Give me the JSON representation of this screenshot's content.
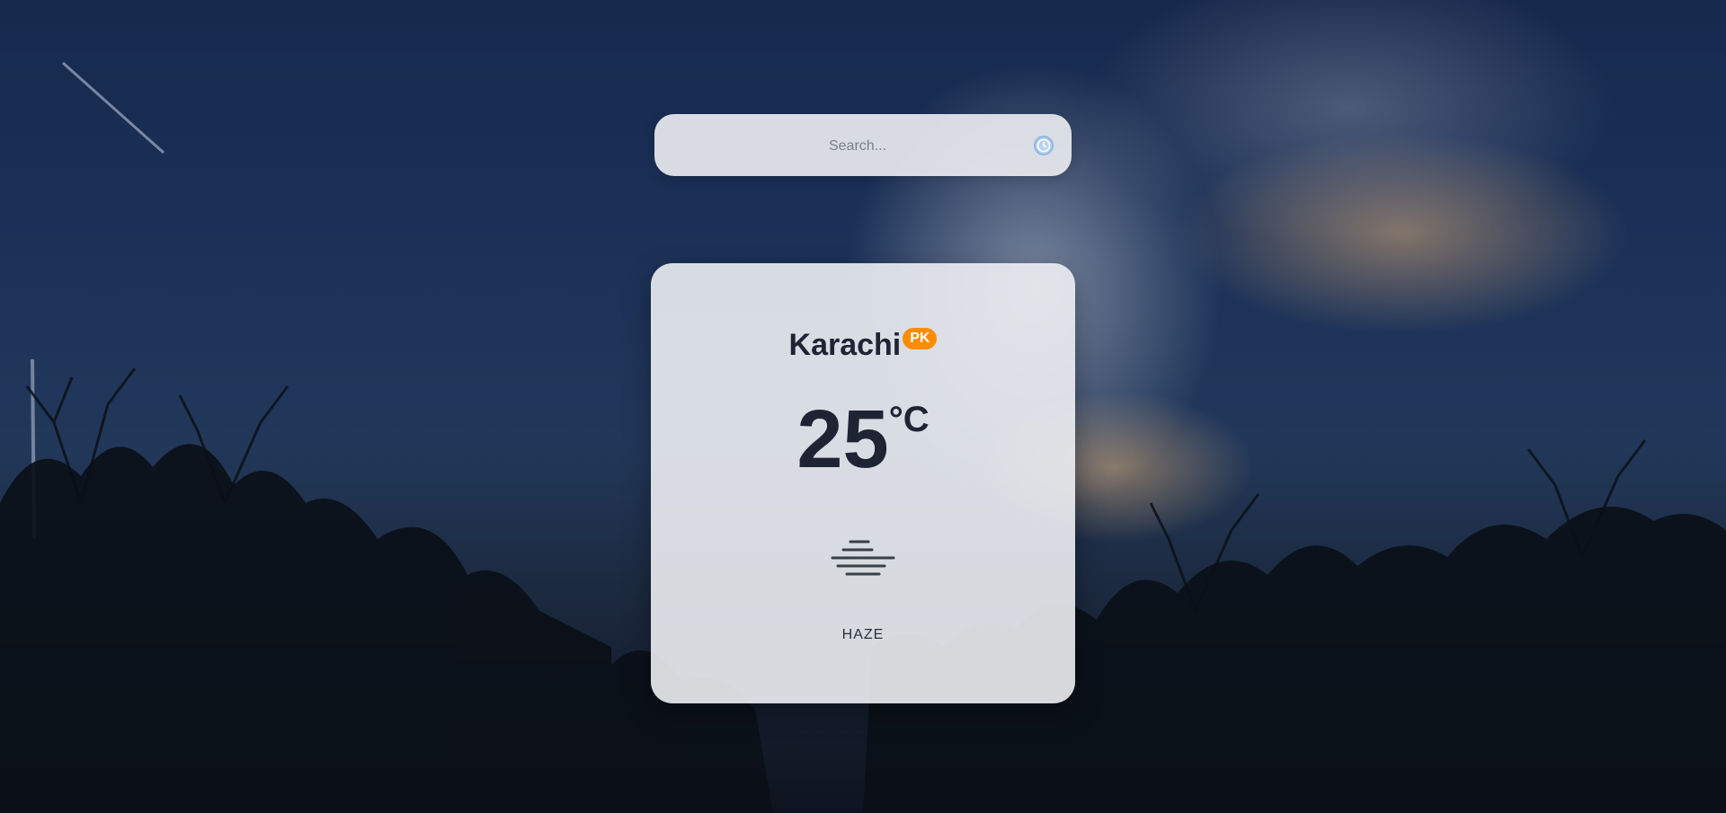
{
  "search": {
    "placeholder": "Search...",
    "icon": "clock-icon"
  },
  "weather": {
    "city": "Karachi",
    "country_code": "PK",
    "temperature": "25",
    "unit": "°C",
    "condition_icon": "haze-icon",
    "description": "HAZE"
  },
  "colors": {
    "country_badge": "#ff8c00",
    "text_dark": "#1e2433",
    "search_icon": "#8fb6e0"
  }
}
